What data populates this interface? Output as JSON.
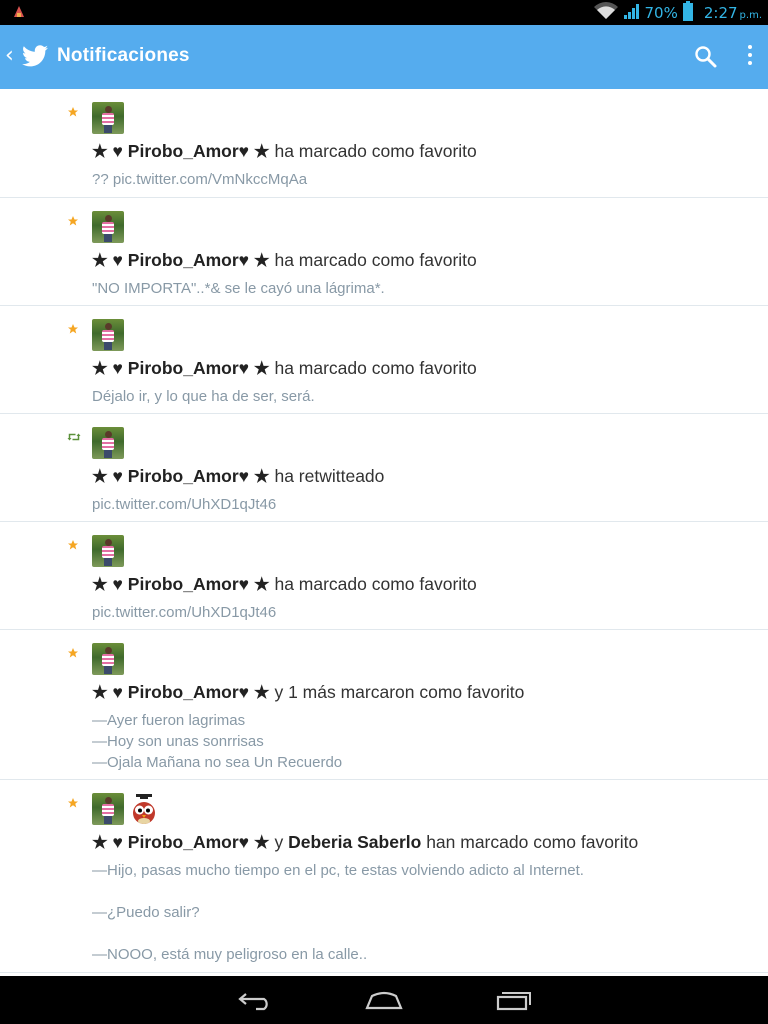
{
  "status_bar": {
    "battery": "70%",
    "time": "2:27",
    "time_suffix": "p.m."
  },
  "app_bar": {
    "title": "Notificaciones"
  },
  "colors": {
    "brand": "#55acee",
    "star": "#f5a623",
    "retweet": "#5c913b",
    "subtext": "#8899a6"
  },
  "notifications": [
    {
      "type": "favorite",
      "user": "★ ♥ Pirobo_Amor♥ ★",
      "action": " ha marcado como favorito",
      "lines": [
        "?? pic.twitter.com/VmNkccMqAa"
      ]
    },
    {
      "type": "favorite",
      "user": "★ ♥ Pirobo_Amor♥ ★",
      "action": " ha marcado como favorito",
      "lines": [
        "\"NO IMPORTA\"..*& se le cayó una lágrima*."
      ]
    },
    {
      "type": "favorite",
      "user": "★ ♥ Pirobo_Amor♥ ★",
      "action": " ha marcado como favorito",
      "lines": [
        "Déjalo ir, y lo que ha de ser, será."
      ]
    },
    {
      "type": "retweet",
      "user": "★ ♥ Pirobo_Amor♥ ★",
      "action": " ha retwitteado",
      "lines": [
        "pic.twitter.com/UhXD1qJt46"
      ]
    },
    {
      "type": "favorite",
      "user": "★ ♥ Pirobo_Amor♥ ★",
      "action": " ha marcado como favorito",
      "lines": [
        "pic.twitter.com/UhXD1qJt46"
      ]
    },
    {
      "type": "favorite",
      "user": "★ ♥ Pirobo_Amor♥ ★",
      "action": " y 1 más marcaron como favorito",
      "lines": [
        "—Ayer fueron lagrimas",
        "—Hoy son unas sonrrisas",
        "—Ojala Mañana no sea Un Recuerdo"
      ]
    },
    {
      "type": "favorite",
      "user": "★ ♥ Pirobo_Amor♥ ★",
      "connector": " y ",
      "user2": "Deberia Saberlo",
      "action": " han marcado como favorito",
      "lines": [
        "—Hijo, pasas mucho tiempo en el pc, te estas volviendo adicto al Internet.",
        "",
        "—¿Puedo salir?",
        "",
        "—NOOO, está muy peligroso en la calle.."
      ]
    }
  ]
}
